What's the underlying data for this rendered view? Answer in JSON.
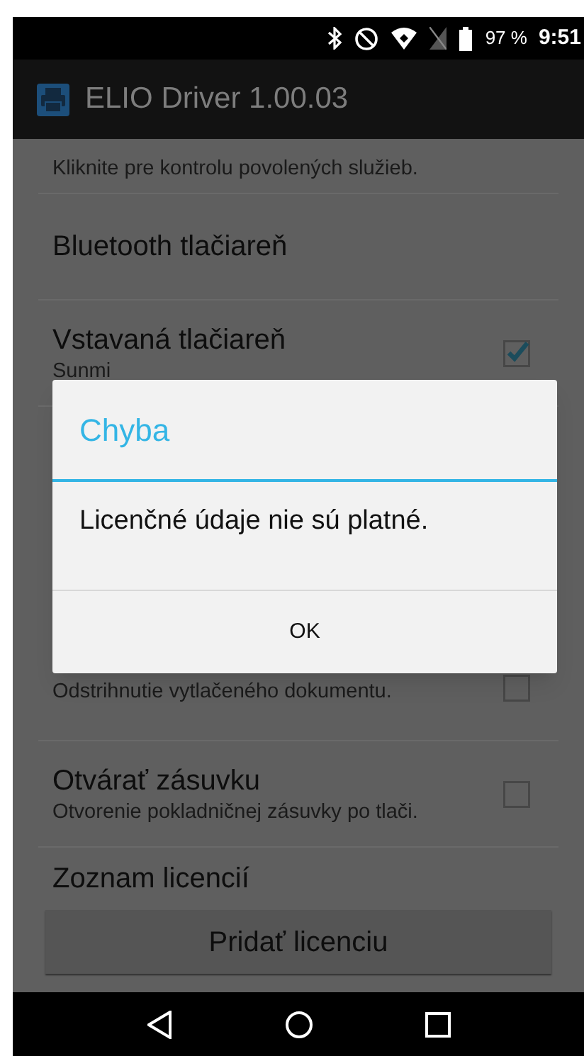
{
  "status_bar": {
    "battery": "97 %",
    "time": "9:51"
  },
  "app_bar": {
    "title": "ELIO Driver 1.00.03"
  },
  "settings": [
    {
      "kind": "partial",
      "summary": "Kliknite pre kontrolu povolených služieb."
    },
    {
      "kind": "plain",
      "title": "Bluetooth tlačiareň"
    },
    {
      "kind": "checkbox",
      "title": "Vstavaná tlačiareň",
      "summary": "Sunmi",
      "checked": true
    },
    {
      "kind": "checkbox",
      "summary": "Odstrihnutie vytlačeného dokumentu.",
      "checked": false
    },
    {
      "kind": "checkbox",
      "title": "Otvárať zásuvku",
      "summary": "Otvorenie pokladničnej zásuvky po tlači.",
      "checked": false
    },
    {
      "kind": "category",
      "title": "Zoznam licencií"
    }
  ],
  "add_button": "Pridať licenciu",
  "dialog": {
    "title": "Chyba",
    "message": "Licenčné údaje nie sú platné.",
    "buttons": [
      "OK"
    ]
  }
}
